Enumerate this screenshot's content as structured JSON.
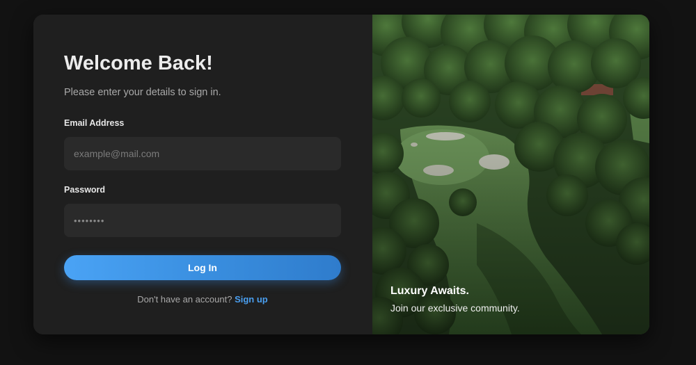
{
  "login": {
    "title": "Welcome Back!",
    "subtitle": "Please enter your details to sign in.",
    "email_label": "Email Address",
    "email_placeholder": "example@mail.com",
    "email_value": "",
    "password_label": "Password",
    "password_value": "••••••••",
    "login_button": "Log In",
    "signup_prompt": "Don't have an account?",
    "signup_link": "Sign up"
  },
  "hero": {
    "title": "Luxury Awaits.",
    "subtitle": "Join our exclusive community.",
    "image": "aerial-golf-course-photo"
  },
  "colors": {
    "background": "#121212",
    "card": "#1f1f1f",
    "input": "#2a2a2a",
    "accent": "#4a9ff0",
    "text_primary": "#ececec",
    "text_secondary": "#a9a9a9"
  }
}
